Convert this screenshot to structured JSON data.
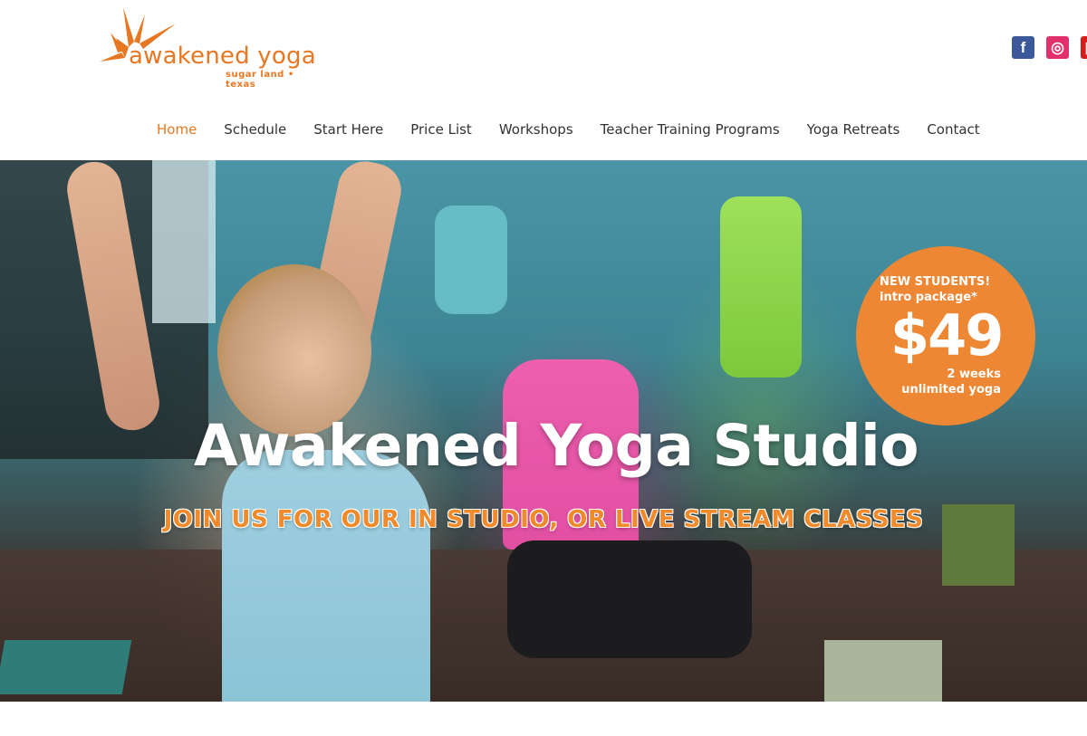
{
  "brand": {
    "name": "awakened yoga",
    "tagline": "sugar land • texas",
    "color": "#e87722"
  },
  "social": [
    {
      "icon": "facebook-icon",
      "glyph": "f"
    },
    {
      "icon": "instagram-icon",
      "glyph": "◎"
    },
    {
      "icon": "youtube-icon",
      "glyph": "▶"
    }
  ],
  "nav": {
    "items": [
      {
        "label": "Home",
        "active": true
      },
      {
        "label": "Schedule"
      },
      {
        "label": "Start Here"
      },
      {
        "label": "Price List"
      },
      {
        "label": "Workshops"
      },
      {
        "label": "Teacher Training Programs"
      },
      {
        "label": "Yoga Retreats"
      },
      {
        "label": "Contact"
      }
    ]
  },
  "hero": {
    "title": "Awakened Yoga Studio",
    "subtitle": "JOIN US FOR OUR IN STUDIO, OR LIVE STREAM CLASSES"
  },
  "promo": {
    "line1": "NEW STUDENTS!",
    "line2": "intro package*",
    "price": "$49",
    "line3": "2 weeks",
    "line4": "unlimited yoga",
    "color": "#ee8734"
  }
}
